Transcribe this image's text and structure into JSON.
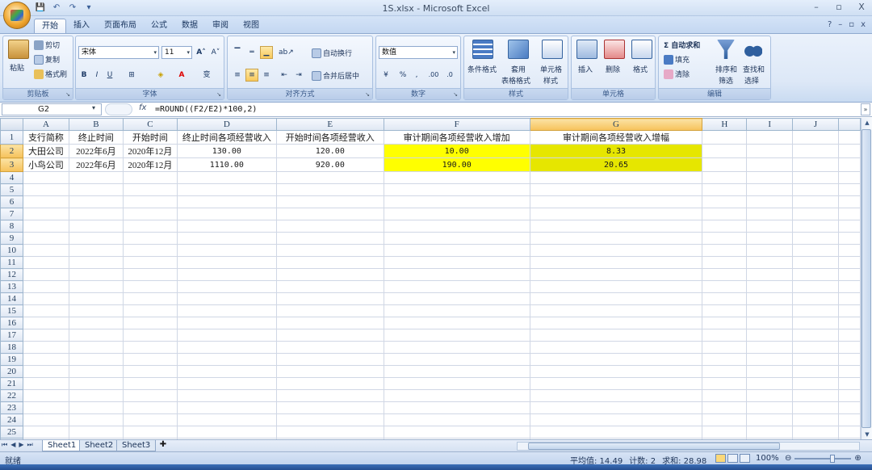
{
  "window": {
    "title": "1S.xlsx - Microsoft Excel",
    "minimize": "–",
    "restore": "▫",
    "close": "X"
  },
  "qat": {
    "save": "💾",
    "undo": "↶",
    "redo": "↷",
    "more": "▾"
  },
  "tabs": [
    "开始",
    "插入",
    "页面布局",
    "公式",
    "数据",
    "审阅",
    "视图"
  ],
  "tab_controls": {
    "help": "?",
    "min": "–",
    "restore": "▫",
    "close": "x"
  },
  "ribbon": {
    "clipboard": {
      "paste": "粘贴",
      "cut": "剪切",
      "copy": "复制",
      "format_painter": "格式刷",
      "label": "剪贴板"
    },
    "font": {
      "name": "宋体",
      "size": "11",
      "grow": "A˄",
      "shrink": "A˅",
      "bold": "B",
      "italic": "I",
      "underline": "U",
      "border": "⊞",
      "fill": "◈",
      "color": "A",
      "phonetic": "变",
      "label": "字体"
    },
    "alignment": {
      "wrap": "自动换行",
      "merge": "合并后居中",
      "label": "对齐方式"
    },
    "number": {
      "format": "数值",
      "currency": "¥",
      "percent": "%",
      "comma": ",",
      "inc": ".00",
      "dec": ".0",
      "label": "数字"
    },
    "styles": {
      "conditional": "条件格式",
      "table_fmt_top": "套用",
      "table_fmt_bottom": "表格格式",
      "cell_style_top": "单元格",
      "cell_style_bottom": "样式",
      "label": "样式"
    },
    "cells": {
      "insert": "插入",
      "delete": "删除",
      "format": "格式",
      "label": "单元格"
    },
    "editing": {
      "autosum": "Σ 自动求和",
      "fill": "填充",
      "clear": "清除",
      "sort_top": "排序和",
      "sort_bottom": "筛选",
      "find_top": "查找和",
      "find_bottom": "选择",
      "label": "编辑"
    }
  },
  "formula_bar": {
    "name_box": "G2",
    "fx": "fx",
    "formula": "=ROUND((F2/E2)*100,2)"
  },
  "columns": [
    "A",
    "B",
    "C",
    "D",
    "E",
    "F",
    "G",
    "H",
    "I",
    "J"
  ],
  "rows": [
    [
      "支行简称",
      "终止时间",
      "开始时间",
      "终止时间各项经营收入",
      "开始时间各项经营收入",
      "审计期间各项经营收入增加",
      "审计期间各项经营收入增幅",
      "",
      "",
      ""
    ],
    [
      "大田公司",
      "2022年6月",
      "2020年12月",
      "130.00",
      "120.00",
      "10.00",
      "8.33",
      "",
      "",
      ""
    ],
    [
      "小鸟公司",
      "2022年6月",
      "2020年12月",
      "1110.00",
      "920.00",
      "190.00",
      "20.65",
      "",
      "",
      ""
    ]
  ],
  "row_count": 26,
  "sheets": [
    "Sheet1",
    "Sheet2",
    "Sheet3"
  ],
  "nav": [
    "⏮",
    "◀",
    "▶",
    "⏭"
  ],
  "status": {
    "ready": "就绪",
    "average": "平均值: 14.49",
    "count": "计数: 2",
    "sum": "求和: 28.98",
    "zoom": "100%",
    "zoom_out": "⊖",
    "zoom_in": "⊕"
  },
  "colors": {
    "highlight": "#ffff00",
    "selection": "#e6e600",
    "header_selected": "#f6c25a"
  }
}
